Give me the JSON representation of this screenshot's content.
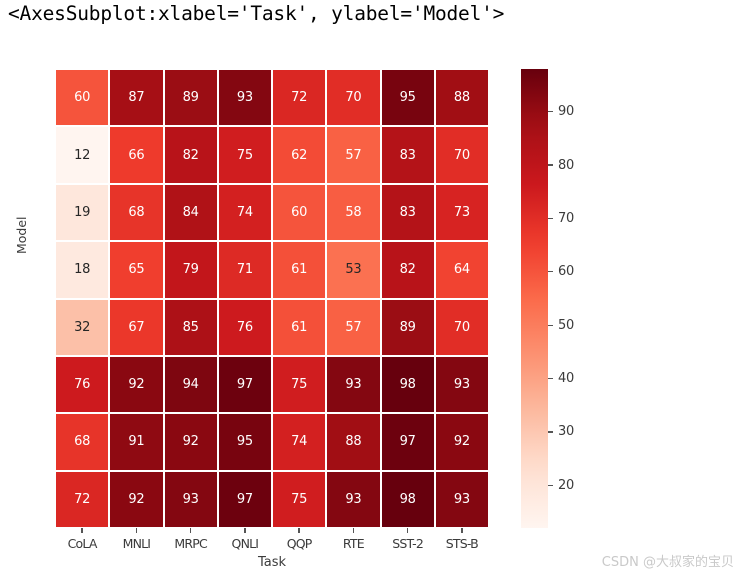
{
  "repr_header": "<AxesSubplot:xlabel='Task', ylabel='Model'>",
  "watermark": "CSDN @大叔家的宝贝",
  "axes": {
    "xlabel": "Task",
    "ylabel": "Model"
  },
  "colorbar": {
    "ticks": [
      90,
      80,
      70,
      60,
      50,
      40,
      30,
      20
    ],
    "vmin": 12,
    "vmax": 98,
    "colormap": "Reds",
    "low_color": "#fff5f0",
    "high_color": "#67000d"
  },
  "chart_data": {
    "type": "heatmap",
    "title": "",
    "xlabel": "Task",
    "ylabel": "Model",
    "categories": [
      "CoLA",
      "MNLI",
      "MRPC",
      "QNLI",
      "QQP",
      "RTE",
      "SST-2",
      "STS-B"
    ],
    "rows": [
      "",
      "",
      "",
      "",
      "",
      "",
      "",
      ""
    ],
    "values": [
      [
        60,
        87,
        89,
        93,
        72,
        70,
        95,
        88
      ],
      [
        12,
        66,
        82,
        75,
        62,
        57,
        83,
        70
      ],
      [
        19,
        68,
        84,
        74,
        60,
        58,
        83,
        73
      ],
      [
        18,
        65,
        79,
        71,
        61,
        53,
        82,
        64
      ],
      [
        32,
        67,
        85,
        76,
        61,
        57,
        89,
        70
      ],
      [
        76,
        92,
        94,
        97,
        75,
        93,
        98,
        93
      ],
      [
        68,
        91,
        92,
        95,
        74,
        88,
        97,
        92
      ],
      [
        72,
        92,
        93,
        97,
        75,
        93,
        98,
        93
      ]
    ],
    "annot": true,
    "vmin": 12,
    "vmax": 98,
    "cmap": "Reds",
    "colorbar_ticks": [
      20,
      30,
      40,
      50,
      60,
      70,
      80,
      90
    ],
    "grid": false,
    "legend_position": "right"
  }
}
